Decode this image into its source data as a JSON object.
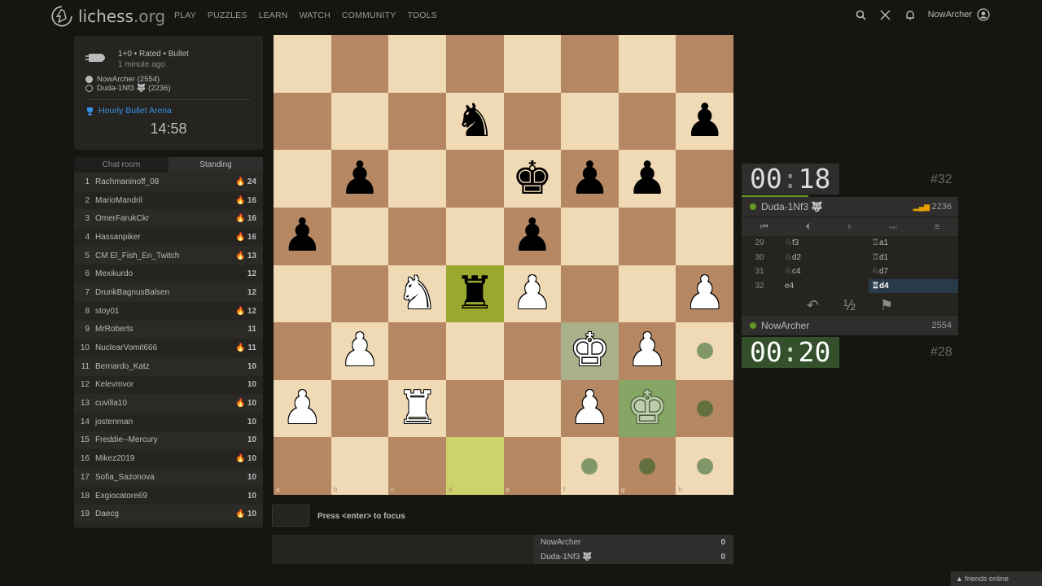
{
  "header": {
    "logo_text": "lichess",
    "logo_suffix": ".org",
    "nav": [
      "PLAY",
      "PUZZLES",
      "LEARN",
      "WATCH",
      "COMMUNITY",
      "TOOLS"
    ],
    "username": "NowArcher"
  },
  "game": {
    "type_line": "1+0 • Rated • Bullet",
    "time_ago": "1 minute ago",
    "white_player": "NowArcher (2554)",
    "black_player": "Duda-1Nf3 🐺 (2236)",
    "arena_name": "Hourly Bullet Arena",
    "arena_clock": "14:58"
  },
  "standings": {
    "tabs": [
      "Chat room",
      "Standing"
    ],
    "rows": [
      {
        "rank": "1",
        "name": "Rachmaninoff_08",
        "fire": true,
        "score": "24"
      },
      {
        "rank": "2",
        "name": "MarioMandril",
        "fire": true,
        "score": "16"
      },
      {
        "rank": "3",
        "name": "OmerFarukCkr",
        "fire": true,
        "score": "16"
      },
      {
        "rank": "4",
        "name": "Hassanpiker",
        "fire": true,
        "score": "16"
      },
      {
        "rank": "5",
        "name": "CM El_Fish_En_Twitch",
        "fire": true,
        "score": "13"
      },
      {
        "rank": "6",
        "name": "Mexikurdo",
        "fire": false,
        "score": "12"
      },
      {
        "rank": "7",
        "name": "DrunkBagnusBalsen",
        "fire": false,
        "score": "12"
      },
      {
        "rank": "8",
        "name": "stoy01",
        "fire": true,
        "score": "12"
      },
      {
        "rank": "9",
        "name": "MrRoberts",
        "fire": false,
        "score": "11"
      },
      {
        "rank": "10",
        "name": "NuclearVomit666",
        "fire": true,
        "score": "11"
      },
      {
        "rank": "11",
        "name": "Bernardo_Katz",
        "fire": false,
        "score": "10"
      },
      {
        "rank": "12",
        "name": "Kelevmvor",
        "fire": false,
        "score": "10"
      },
      {
        "rank": "13",
        "name": "cuvilla10",
        "fire": true,
        "score": "10"
      },
      {
        "rank": "14",
        "name": "jostenman",
        "fire": false,
        "score": "10"
      },
      {
        "rank": "15",
        "name": "Freddie--Mercury",
        "fire": false,
        "score": "10"
      },
      {
        "rank": "16",
        "name": "Mikez2019",
        "fire": true,
        "score": "10"
      },
      {
        "rank": "17",
        "name": "Sofia_Sazonova",
        "fire": false,
        "score": "10"
      },
      {
        "rank": "18",
        "name": "Exgiocatore69",
        "fire": false,
        "score": "10"
      },
      {
        "rank": "19",
        "name": "Daecg",
        "fire": true,
        "score": "10"
      }
    ]
  },
  "board": {
    "files": [
      "a",
      "b",
      "c",
      "d",
      "e",
      "f",
      "g",
      "h"
    ],
    "ranks": [
      "8",
      "7",
      "6",
      "5",
      "4",
      "3",
      "2",
      "1"
    ],
    "pieces": [
      {
        "sq": "d7",
        "p": "n",
        "c": "b"
      },
      {
        "sq": "h7",
        "p": "p",
        "c": "b"
      },
      {
        "sq": "b6",
        "p": "p",
        "c": "b"
      },
      {
        "sq": "e6",
        "p": "k",
        "c": "b"
      },
      {
        "sq": "f6",
        "p": "p",
        "c": "b"
      },
      {
        "sq": "g6",
        "p": "p",
        "c": "b"
      },
      {
        "sq": "a5",
        "p": "p",
        "c": "b"
      },
      {
        "sq": "e5",
        "p": "p",
        "c": "b"
      },
      {
        "sq": "c4",
        "p": "n",
        "c": "w"
      },
      {
        "sq": "d4",
        "p": "r",
        "c": "b"
      },
      {
        "sq": "e4",
        "p": "p",
        "c": "w"
      },
      {
        "sq": "h4",
        "p": "p",
        "c": "w"
      },
      {
        "sq": "b3",
        "p": "p",
        "c": "w"
      },
      {
        "sq": "f3",
        "p": "k",
        "c": "w"
      },
      {
        "sq": "g3",
        "p": "p",
        "c": "w"
      },
      {
        "sq": "a2",
        "p": "p",
        "c": "w"
      },
      {
        "sq": "c2",
        "p": "r",
        "c": "w"
      },
      {
        "sq": "f2",
        "p": "p",
        "c": "w"
      },
      {
        "sq": "g2",
        "p": "k",
        "c": "w",
        "ghost": true
      }
    ],
    "highlights": [
      {
        "sq": "d4",
        "kind": "hl-rook"
      },
      {
        "sq": "d1",
        "kind": "hl-empty"
      },
      {
        "sq": "f3",
        "kind": "hl-king"
      },
      {
        "sq": "g2",
        "kind": "hl-king2"
      }
    ],
    "dots": [
      "h3",
      "h2",
      "f1",
      "g1",
      "h1"
    ]
  },
  "clocks": {
    "top": {
      "min": "00",
      "sec": "18",
      "rank": "#32"
    },
    "bottom": {
      "min": "00",
      "sec": "20",
      "rank": "#28"
    }
  },
  "players": {
    "top": {
      "name": "Duda-1Nf3 🐺",
      "rating": "2236"
    },
    "bottom": {
      "name": "NowArcher",
      "rating": "2554"
    }
  },
  "moves": [
    {
      "n": "29",
      "w": "♘f3",
      "b": "♖a1"
    },
    {
      "n": "30",
      "w": "♘d2",
      "b": "♖d1"
    },
    {
      "n": "31",
      "w": "♘c4",
      "b": "♘d7"
    },
    {
      "n": "32",
      "w": "e4",
      "b": "♖d4"
    }
  ],
  "focus_hint": "Press <enter> to focus",
  "score": {
    "p1": "NowArcher",
    "s1": "0",
    "p2": "Duda-1Nf3 🐺",
    "s2": "0"
  },
  "friends": "friends online",
  "colors": {
    "accent": "#3692e7",
    "green": "#629924",
    "board_light": "#f0d9b5",
    "board_dark": "#b58863"
  }
}
